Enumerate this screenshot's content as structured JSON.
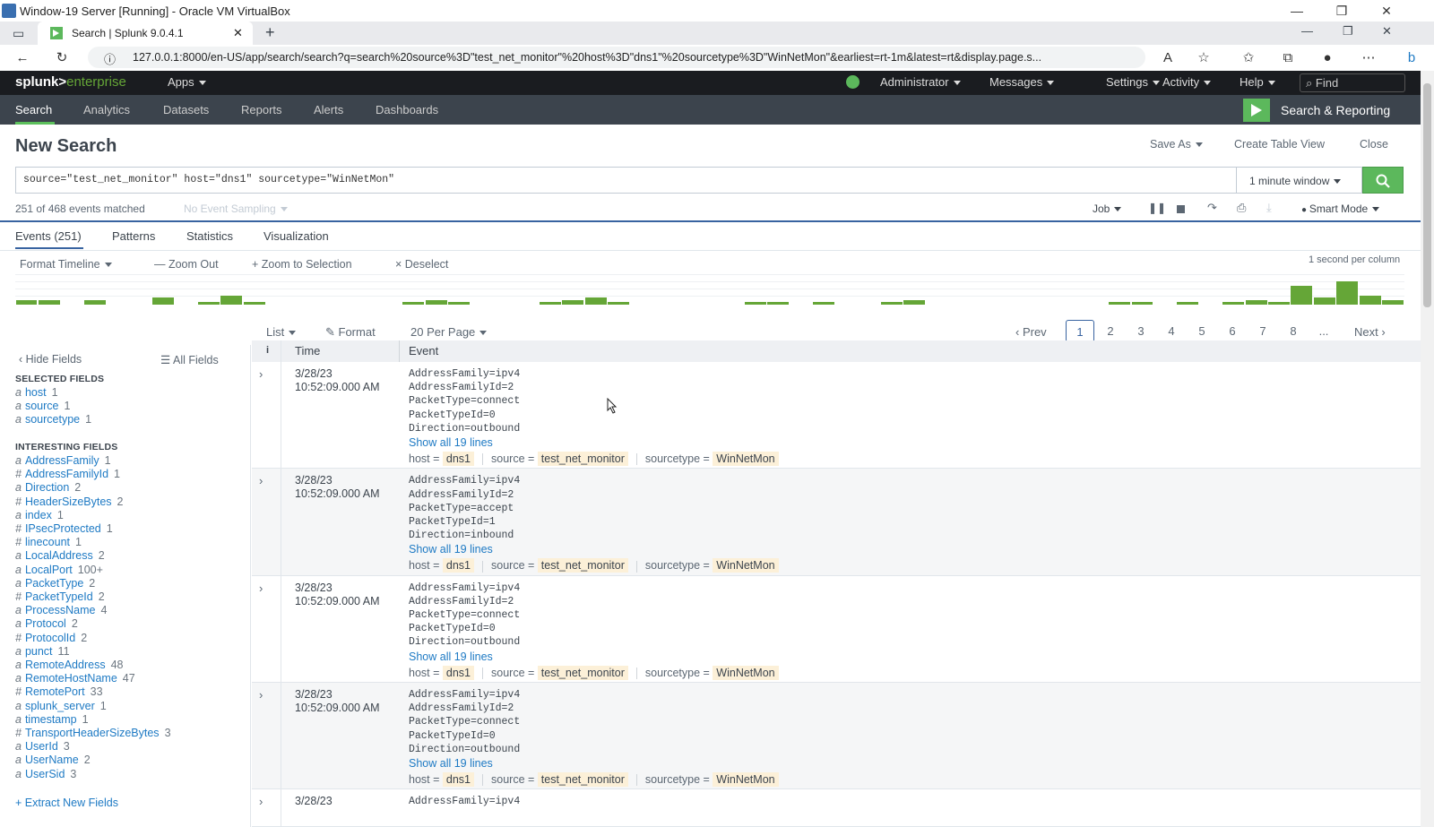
{
  "window": {
    "title": "Window-19 Server [Running] - Oracle VM VirtualBox"
  },
  "browser": {
    "tab_title": "Search | Splunk 9.0.4.1",
    "url": "127.0.0.1:8000/en-US/app/search/search?q=search%20source%3D\"test_net_monitor\"%20host%3D\"dns1\"%20sourcetype%3D\"WinNetMon\"&earliest=rt-1m&latest=rt&display.page.s..."
  },
  "splunk_bar": {
    "logo_a": "splunk>",
    "logo_b": "enterprise",
    "apps": "Apps",
    "user": "Administrator",
    "messages": "Messages",
    "settings": "Settings",
    "activity": "Activity",
    "help": "Help",
    "find": "Find"
  },
  "nav": {
    "items": [
      "Search",
      "Analytics",
      "Datasets",
      "Reports",
      "Alerts",
      "Dashboards"
    ],
    "app_name": "Search & Reporting"
  },
  "page": {
    "title": "New Search",
    "save_as": "Save As",
    "create_table_view": "Create Table View",
    "close": "Close",
    "query": "source=\"test_net_monitor\" host=\"dns1\" sourcetype=\"WinNetMon\"",
    "time_window": "1 minute window",
    "matched": "251 of 468 events matched",
    "sampling": "No Event Sampling",
    "job": "Job",
    "mode": "Smart Mode"
  },
  "tabs": [
    "Events (251)",
    "Patterns",
    "Statistics",
    "Visualization"
  ],
  "timeline": {
    "format": "Format Timeline",
    "zoom_out": "— Zoom Out",
    "zoom_sel": "+ Zoom to Selection",
    "deselect": "× Deselect",
    "scale": "1 second per column",
    "bars": [
      2,
      2,
      0,
      2,
      0,
      0,
      3,
      0,
      1,
      4,
      1,
      0,
      0,
      0,
      0,
      0,
      0,
      1,
      2,
      1,
      0,
      0,
      0,
      1,
      2,
      3,
      1,
      0,
      0,
      0,
      0,
      0,
      1,
      1,
      0,
      1,
      0,
      0,
      1,
      2,
      0,
      0,
      0,
      0,
      0,
      0,
      0,
      0,
      1,
      1,
      0,
      1,
      0,
      1,
      2,
      1,
      8,
      3,
      10,
      4,
      2
    ]
  },
  "listbar": {
    "list": "List",
    "format": "Format",
    "per_page": "20 Per Page",
    "prev": "‹ Prev",
    "pages": [
      "1",
      "2",
      "3",
      "4",
      "5",
      "6",
      "7",
      "8",
      "..."
    ],
    "next": "Next ›"
  },
  "sidebar": {
    "hide": "Hide Fields",
    "all": "All Fields",
    "selected_header": "SELECTED FIELDS",
    "selected": [
      {
        "t": "a",
        "name": "host",
        "count": "1"
      },
      {
        "t": "a",
        "name": "source",
        "count": "1"
      },
      {
        "t": "a",
        "name": "sourcetype",
        "count": "1"
      }
    ],
    "interesting_header": "INTERESTING FIELDS",
    "interesting": [
      {
        "t": "a",
        "name": "AddressFamily",
        "count": "1"
      },
      {
        "t": "#",
        "name": "AddressFamilyId",
        "count": "1"
      },
      {
        "t": "a",
        "name": "Direction",
        "count": "2"
      },
      {
        "t": "#",
        "name": "HeaderSizeBytes",
        "count": "2"
      },
      {
        "t": "a",
        "name": "index",
        "count": "1"
      },
      {
        "t": "#",
        "name": "IPsecProtected",
        "count": "1"
      },
      {
        "t": "#",
        "name": "linecount",
        "count": "1"
      },
      {
        "t": "a",
        "name": "LocalAddress",
        "count": "2"
      },
      {
        "t": "a",
        "name": "LocalPort",
        "count": "100+"
      },
      {
        "t": "a",
        "name": "PacketType",
        "count": "2"
      },
      {
        "t": "#",
        "name": "PacketTypeId",
        "count": "2"
      },
      {
        "t": "a",
        "name": "ProcessName",
        "count": "4"
      },
      {
        "t": "a",
        "name": "Protocol",
        "count": "2"
      },
      {
        "t": "#",
        "name": "ProtocolId",
        "count": "2"
      },
      {
        "t": "a",
        "name": "punct",
        "count": "11"
      },
      {
        "t": "a",
        "name": "RemoteAddress",
        "count": "48"
      },
      {
        "t": "a",
        "name": "RemoteHostName",
        "count": "47"
      },
      {
        "t": "#",
        "name": "RemotePort",
        "count": "33"
      },
      {
        "t": "a",
        "name": "splunk_server",
        "count": "1"
      },
      {
        "t": "a",
        "name": "timestamp",
        "count": "1"
      },
      {
        "t": "#",
        "name": "TransportHeaderSizeBytes",
        "count": "3"
      },
      {
        "t": "a",
        "name": "UserId",
        "count": "3"
      },
      {
        "t": "a",
        "name": "UserName",
        "count": "2"
      },
      {
        "t": "a",
        "name": "UserSid",
        "count": "3"
      }
    ],
    "extract": "+ Extract New Fields"
  },
  "table": {
    "col_i": "i",
    "col_time": "Time",
    "col_event": "Event",
    "show_all": "Show all 19 lines",
    "meta": {
      "host_k": "host =",
      "host_v": "dns1",
      "source_k": "source =",
      "source_v": "test_net_monitor",
      "st_k": "sourcetype =",
      "st_v": "WinNetMon"
    },
    "events": [
      {
        "date": "3/28/23",
        "time": "10:52:09.000 AM",
        "lines": [
          "AddressFamily=ipv4",
          "AddressFamilyId=2",
          "PacketType=connect",
          "PacketTypeId=0",
          "Direction=outbound"
        ]
      },
      {
        "date": "3/28/23",
        "time": "10:52:09.000 AM",
        "lines": [
          "AddressFamily=ipv4",
          "AddressFamilyId=2",
          "PacketType=accept",
          "PacketTypeId=1",
          "Direction=inbound"
        ]
      },
      {
        "date": "3/28/23",
        "time": "10:52:09.000 AM",
        "lines": [
          "AddressFamily=ipv4",
          "AddressFamilyId=2",
          "PacketType=connect",
          "PacketTypeId=0",
          "Direction=outbound"
        ]
      },
      {
        "date": "3/28/23",
        "time": "10:52:09.000 AM",
        "lines": [
          "AddressFamily=ipv4",
          "AddressFamilyId=2",
          "PacketType=connect",
          "PacketTypeId=0",
          "Direction=outbound"
        ]
      },
      {
        "date": "3/28/23",
        "time": "",
        "lines": [
          "AddressFamily=ipv4"
        ]
      }
    ]
  },
  "colors": {
    "accent": "#5cb85c",
    "link": "#1e7ac4",
    "nav": "#3c444d",
    "topbar": "#1a1c20"
  }
}
